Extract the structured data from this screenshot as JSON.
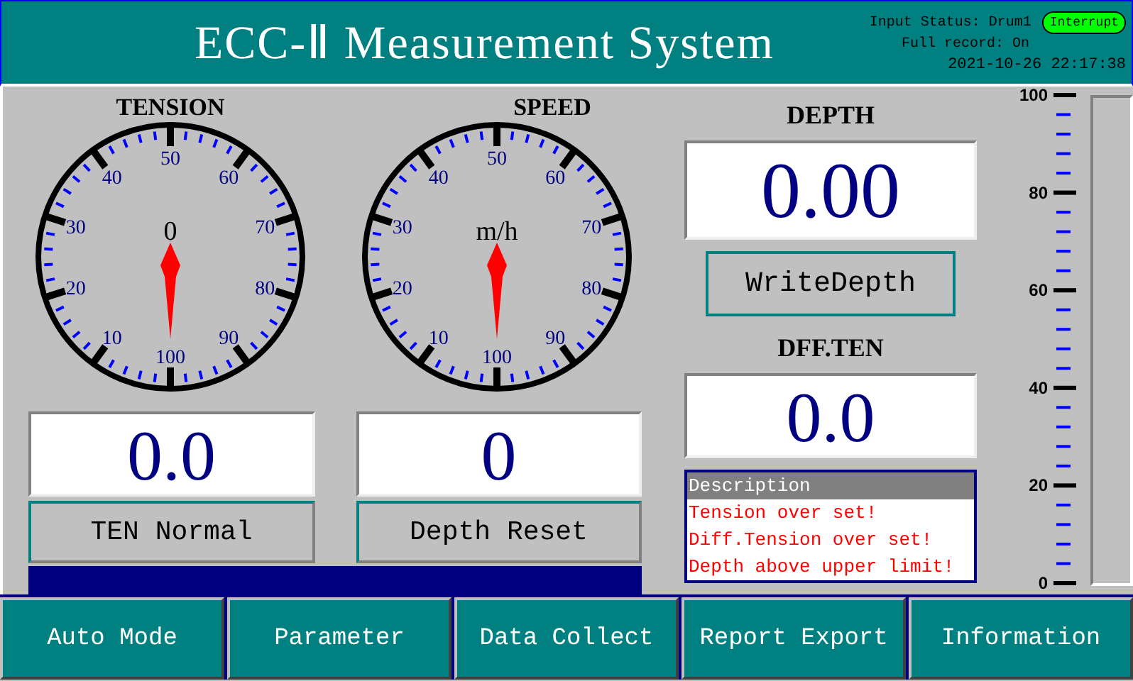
{
  "header": {
    "title": "ECC-Ⅱ Measurement System",
    "input_status": "Input Status: Drum1",
    "status_badge": "Interrupt",
    "full_record": "Full record: On",
    "datetime": "2021-10-26 22:17:38"
  },
  "gauges": [
    {
      "title": "TENSION",
      "unit": "0",
      "scale_labels": [
        "10",
        "20",
        "30",
        "40",
        "50",
        "60",
        "70",
        "80",
        "90",
        "100"
      ],
      "value": "0.0",
      "button": "TEN Normal"
    },
    {
      "title": "SPEED",
      "unit": "m/h",
      "scale_labels": [
        "10",
        "20",
        "30",
        "40",
        "50",
        "60",
        "70",
        "80",
        "90",
        "100"
      ],
      "value": "0",
      "button": "Depth Reset"
    }
  ],
  "depth": {
    "title": "DEPTH",
    "value": "0.00",
    "button": "WriteDepth"
  },
  "diff_tension": {
    "title": "DFF.TEN",
    "value": "0.0"
  },
  "alarms": {
    "header": "Description",
    "items": [
      "Tension over set!",
      "Diff.Tension over set!",
      "Depth above upper limit!"
    ]
  },
  "depth_meter": {
    "level": 0,
    "scale_labels": [
      "100",
      "80",
      "60",
      "40",
      "20",
      "0"
    ]
  },
  "nav_buttons": [
    "Auto Mode",
    "Parameter",
    "Data Collect",
    "Report Export",
    "Information"
  ]
}
